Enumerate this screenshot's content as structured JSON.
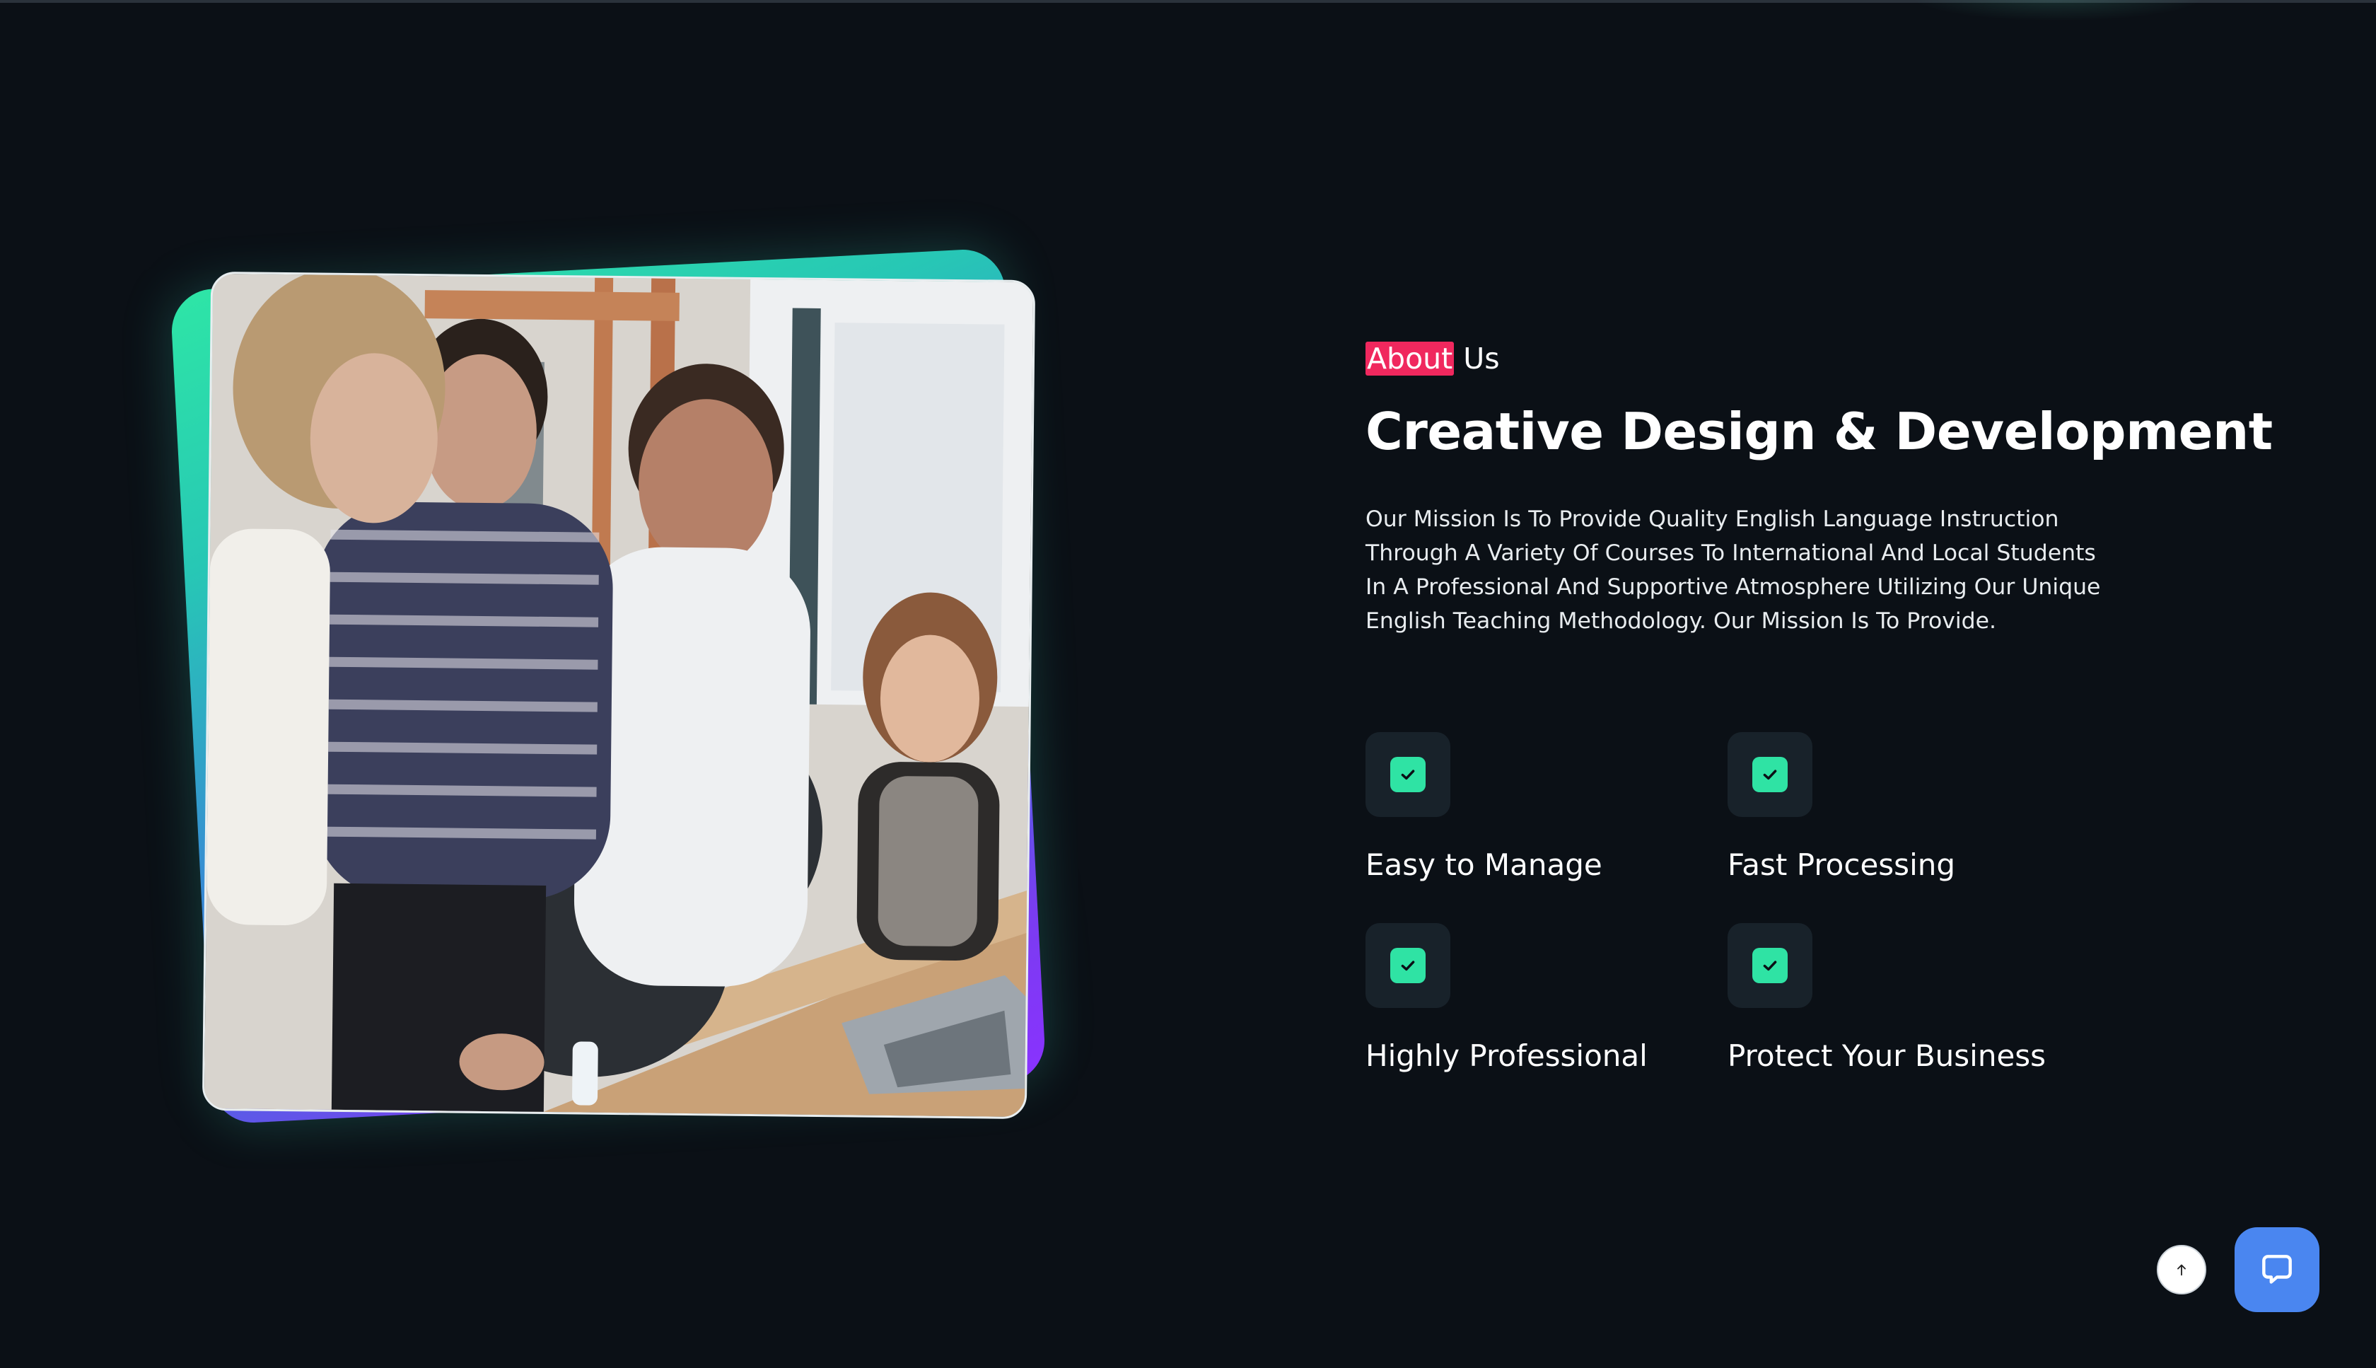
{
  "about": {
    "tag_highlight": "About",
    "tag_rest": " Us",
    "title": "Creative Design & Development",
    "description": "Our Mission Is To Provide Quality English Language Instruction Through A Variety Of Courses To International And Local Students In A Professional And Supportive Atmosphere Utilizing Our Unique English Teaching Methodology. Our Mission Is To Provide."
  },
  "features": [
    {
      "label": "Easy to Manage",
      "icon": "check-icon"
    },
    {
      "label": "Fast Processing",
      "icon": "check-icon"
    },
    {
      "label": "Highly Professional",
      "icon": "check-icon"
    },
    {
      "label": "Protect Your Business",
      "icon": "check-icon"
    }
  ],
  "colors": {
    "background": "#0b1016",
    "accent_pink": "#f0285e",
    "accent_green": "#2fe3a4",
    "accent_purple": "#8a32ff",
    "chat_blue": "#4a86f0"
  },
  "floating": {
    "scroll_top_icon": "arrow-up-icon",
    "chat_icon": "chat-bubble-icon"
  },
  "image": {
    "subject": "team-photo"
  }
}
